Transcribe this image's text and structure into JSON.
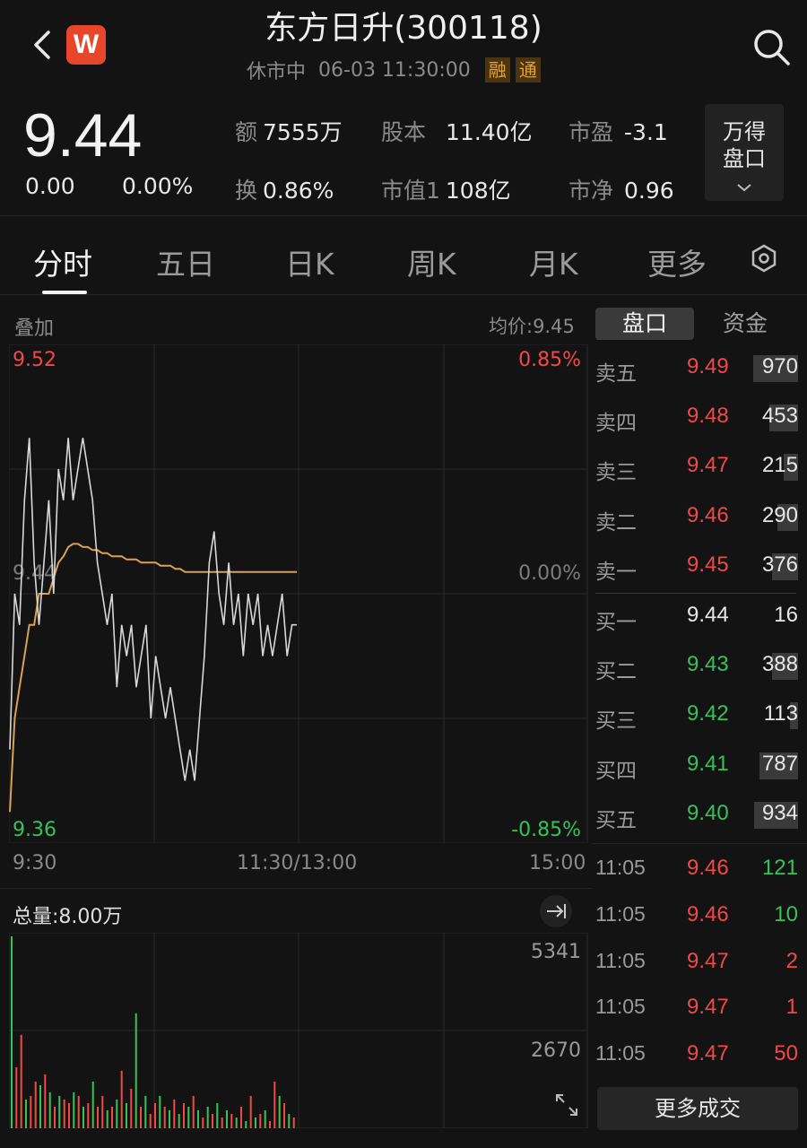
{
  "header": {
    "title": "东方日升(300118)",
    "status": "休市中",
    "datetime": "06-03 11:30:00",
    "tags": [
      "融",
      "通"
    ],
    "logo_letter": "W"
  },
  "quote": {
    "price": "9.44",
    "change": "0.00",
    "change_pct": "0.00%",
    "stats": [
      {
        "k": "额",
        "v": "7555万"
      },
      {
        "k": "股本",
        "v": "11.40亿"
      },
      {
        "k": "市盈",
        "v": "-3.1"
      },
      {
        "k": "换",
        "v": "0.86%"
      },
      {
        "k": "市值1",
        "v": "108亿"
      },
      {
        "k": "市净",
        "v": "0.96"
      }
    ],
    "wind_button": "万得\n盘口",
    "wind_button_line1": "万得",
    "wind_button_line2": "盘口"
  },
  "tabs": [
    {
      "label": "分时",
      "active": true
    },
    {
      "label": "五日",
      "active": false
    },
    {
      "label": "日K",
      "active": false
    },
    {
      "label": "周K",
      "active": false
    },
    {
      "label": "月K",
      "active": false
    },
    {
      "label": "更多",
      "active": false
    }
  ],
  "chart_panel": {
    "overlay_label": "叠加",
    "avg_label": "均价:9.45",
    "time_start": "9:30",
    "time_mid": "11:30/13:00",
    "time_end": "15:00",
    "volume_total": "总量:8.00万"
  },
  "chart_data": [
    {
      "type": "line",
      "ylim": [
        9.36,
        9.52
      ],
      "yticks_left": [
        "9.52",
        "9.44",
        "9.36"
      ],
      "yticks_right": [
        "0.85%",
        "0.00%",
        "-0.85%"
      ],
      "series": [
        {
          "name": "price",
          "color": "#d8d8d8",
          "values": [
            9.39,
            9.44,
            9.43,
            9.47,
            9.49,
            9.45,
            9.43,
            9.45,
            9.47,
            9.44,
            9.48,
            9.47,
            9.49,
            9.47,
            9.48,
            9.49,
            9.48,
            9.47,
            9.45,
            9.44,
            9.43,
            9.44,
            9.41,
            9.43,
            9.42,
            9.43,
            9.41,
            9.42,
            9.43,
            9.4,
            9.42,
            9.41,
            9.4,
            9.41,
            9.4,
            9.39,
            9.38,
            9.39,
            9.38,
            9.4,
            9.42,
            9.45,
            9.46,
            9.44,
            9.43,
            9.45,
            9.43,
            9.44,
            9.42,
            9.44,
            9.43,
            9.44,
            9.42,
            9.43,
            9.42,
            9.43,
            9.44,
            9.42,
            9.43,
            9.43
          ]
        },
        {
          "name": "avg",
          "color": "#d9a253",
          "values": [
            9.37,
            9.4,
            9.41,
            9.42,
            9.43,
            9.43,
            9.44,
            9.44,
            9.44,
            9.445,
            9.45,
            9.452,
            9.455,
            9.456,
            9.456,
            9.455,
            9.455,
            9.454,
            9.454,
            9.453,
            9.453,
            9.452,
            9.452,
            9.452,
            9.451,
            9.451,
            9.451,
            9.45,
            9.45,
            9.45,
            9.45,
            9.449,
            9.449,
            9.449,
            9.448,
            9.448,
            9.447,
            9.447,
            9.447,
            9.447,
            9.447,
            9.447,
            9.447,
            9.447,
            9.447,
            9.447,
            9.447,
            9.447,
            9.447,
            9.447,
            9.447,
            9.447,
            9.447,
            9.447,
            9.447,
            9.447,
            9.447,
            9.447,
            9.447,
            9.447
          ]
        }
      ]
    },
    {
      "type": "bar",
      "ylim": [
        0,
        5341
      ],
      "yticks": [
        "5341",
        "2670"
      ],
      "values": [
        5341,
        1700,
        2600,
        800,
        900,
        1300,
        1200,
        1500,
        1000,
        600,
        900,
        800,
        700,
        1000,
        900,
        600,
        700,
        1300,
        600,
        900,
        500,
        600,
        800,
        1600,
        700,
        1100,
        3200,
        600,
        900,
        400,
        700,
        900,
        600,
        500,
        800,
        400,
        700,
        600,
        900,
        500,
        300,
        600,
        400,
        700,
        300,
        500,
        400,
        300,
        600,
        200,
        900,
        300,
        400,
        500,
        200,
        1300,
        900,
        700,
        400,
        300
      ],
      "colors": [
        "g",
        "r",
        "r",
        "g",
        "r",
        "r",
        "g",
        "r",
        "g",
        "r",
        "g",
        "r",
        "r",
        "g",
        "r",
        "g",
        "r",
        "g",
        "r",
        "r",
        "g",
        "r",
        "g",
        "r",
        "g",
        "r",
        "g",
        "r",
        "g",
        "r",
        "r",
        "g",
        "r",
        "g",
        "r",
        "g",
        "r",
        "g",
        "r",
        "g",
        "r",
        "g",
        "r",
        "g",
        "r",
        "g",
        "r",
        "g",
        "r",
        "g",
        "r",
        "g",
        "r",
        "g",
        "r",
        "r",
        "g",
        "r",
        "g",
        "r"
      ]
    }
  ],
  "orderbook": {
    "tab_pankou": "盘口",
    "tab_zijin": "资金",
    "asks": [
      {
        "label": "卖五",
        "price": "9.49",
        "vol": "970",
        "frac": 0.7
      },
      {
        "label": "卖四",
        "price": "9.48",
        "vol": "453",
        "frac": 0.45
      },
      {
        "label": "卖三",
        "price": "9.47",
        "vol": "215",
        "frac": 0.22
      },
      {
        "label": "卖二",
        "price": "9.46",
        "vol": "290",
        "frac": 0.32
      },
      {
        "label": "卖一",
        "price": "9.45",
        "vol": "376",
        "frac": 0.4
      }
    ],
    "bids": [
      {
        "label": "买一",
        "price": "9.44",
        "vol": "16",
        "frac": 0.0
      },
      {
        "label": "买二",
        "price": "9.43",
        "vol": "388",
        "frac": 0.4
      },
      {
        "label": "买三",
        "price": "9.42",
        "vol": "113",
        "frac": 0.12
      },
      {
        "label": "买四",
        "price": "9.41",
        "vol": "787",
        "frac": 0.6
      },
      {
        "label": "买五",
        "price": "9.40",
        "vol": "934",
        "frac": 0.68
      }
    ],
    "trades": [
      {
        "time": "11:05",
        "price": "9.46",
        "vol": "121",
        "dir": "green"
      },
      {
        "time": "11:05",
        "price": "9.46",
        "vol": "10",
        "dir": "green"
      },
      {
        "time": "11:05",
        "price": "9.47",
        "vol": "2",
        "dir": "red"
      },
      {
        "time": "11:05",
        "price": "9.47",
        "vol": "1",
        "dir": "red"
      },
      {
        "time": "11:05",
        "price": "9.47",
        "vol": "50",
        "dir": "red"
      }
    ],
    "more_trades": "更多成交"
  },
  "colors": {
    "up": "#f24848",
    "down": "#35c25b",
    "avg": "#d9a253",
    "price_line": "#d8d8d8",
    "accent_logo": "#e8462b"
  },
  "icons": [
    "back-arrow-icon",
    "search-icon",
    "settings-hexagon-icon",
    "collapse-right-icon",
    "expand-diagonal-icon",
    "chevron-down-icon"
  ]
}
